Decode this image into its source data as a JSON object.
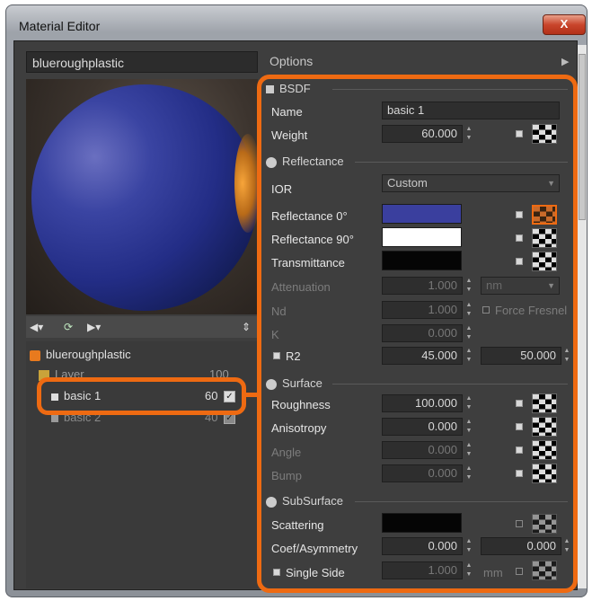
{
  "window": {
    "title": "Material Editor",
    "close_label": "X"
  },
  "left": {
    "material_name": "blueroughplastic",
    "tree": {
      "root": "blueroughplastic",
      "layer": {
        "label": "Layer",
        "value": "100"
      },
      "items": [
        {
          "label": "basic 1",
          "value": "60",
          "checked": true
        },
        {
          "label": "basic 2",
          "value": "40",
          "checked": true
        }
      ]
    }
  },
  "right": {
    "options_label": "Options",
    "bsdf": {
      "header": "BSDF",
      "name_label": "Name",
      "name_value": "basic 1",
      "weight_label": "Weight",
      "weight_value": "60.000"
    },
    "reflectance": {
      "header": "Reflectance",
      "ior_label": "IOR",
      "ior_value": "Custom",
      "refl0_label": "Reflectance 0°",
      "refl0_color": "#3a3f9e",
      "refl90_label": "Reflectance 90°",
      "refl90_color": "#ffffff",
      "trans_label": "Transmittance",
      "trans_color": "#050505",
      "atten_label": "Attenuation",
      "atten_value": "1.000",
      "atten_unit": "nm",
      "nd_label": "Nd",
      "nd_value": "1.000",
      "force_fresnel_label": "Force Fresnel",
      "k_label": "K",
      "k_value": "0.000",
      "r2_label": "R2",
      "r2_value1": "45.000",
      "r2_value2": "50.000"
    },
    "surface": {
      "header": "Surface",
      "roughness_label": "Roughness",
      "roughness_value": "100.000",
      "aniso_label": "Anisotropy",
      "aniso_value": "0.000",
      "angle_label": "Angle",
      "angle_value": "0.000",
      "bump_label": "Bump",
      "bump_value": "0.000"
    },
    "subsurface": {
      "header": "SubSurface",
      "scattering_label": "Scattering",
      "scattering_color": "#050505",
      "coef_label": "Coef/Asymmetry",
      "coef_value1": "0.000",
      "coef_value2": "0.000",
      "single_side_label": "Single Side",
      "single_side_value": "1.000",
      "single_side_unit": "mm"
    }
  },
  "colors": {
    "highlight": "#ee6a12",
    "panel": "#3e3e3e"
  }
}
